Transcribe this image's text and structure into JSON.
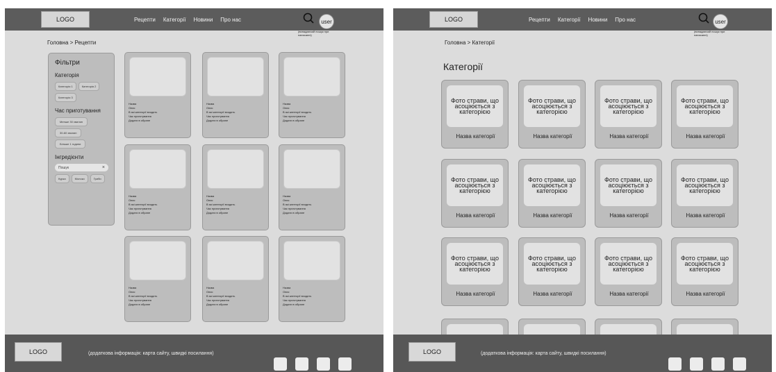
{
  "recipes": {
    "header": {
      "logo": "LOGO",
      "nav": [
        "Рецепти",
        "Категорії",
        "Новини",
        "Про нас"
      ],
      "user": "user",
      "search_note": "(випадаючий пошук при написанні)"
    },
    "breadcrumb": "Головна > Рецепти",
    "filters": {
      "title": "Фільтри",
      "category_label": "Категорія",
      "categories": [
        "Категорія 1",
        "Категорія 2",
        "Категорія 3"
      ],
      "time_label": "Час приготування",
      "times": [
        "Менше 30 хвилин",
        "30-60 хвилин",
        "Більше 1 години"
      ],
      "ingredients_label": "Інгредієнти",
      "search_placeholder": "Пошук",
      "search_clear": "×",
      "ingredients": [
        "Курка",
        "Молоко",
        "Гриби"
      ]
    },
    "card": {
      "name": "Назва",
      "desc": "Опис",
      "cats": "В які категорії входить",
      "time": "Час приготування",
      "fav": "Додати в обране"
    },
    "footer": {
      "logo": "LOGO",
      "text": "(додаткова інформація: карта сайту, швидкі посилання)"
    }
  },
  "categories": {
    "header": {
      "logo": "LOGO",
      "nav": [
        "Рецепти",
        "Категорії",
        "Новини",
        "Про нас"
      ],
      "user": "user",
      "search_note": "(випадаючий пошук при написанні)"
    },
    "breadcrumb": "Головна > Категорії",
    "title": "Категорії",
    "card": {
      "photo": "Фото страви, що асоціюється з категорією",
      "name": "Назва категорії"
    },
    "footer": {
      "logo": "LOGO",
      "text": "(додаткова інформація: карта сайту, швидкі посилання)"
    }
  },
  "colors": {
    "header": "#5c5c5c",
    "footer": "#575757",
    "page": "#dcdcdc",
    "card": "#bdbdbd"
  }
}
